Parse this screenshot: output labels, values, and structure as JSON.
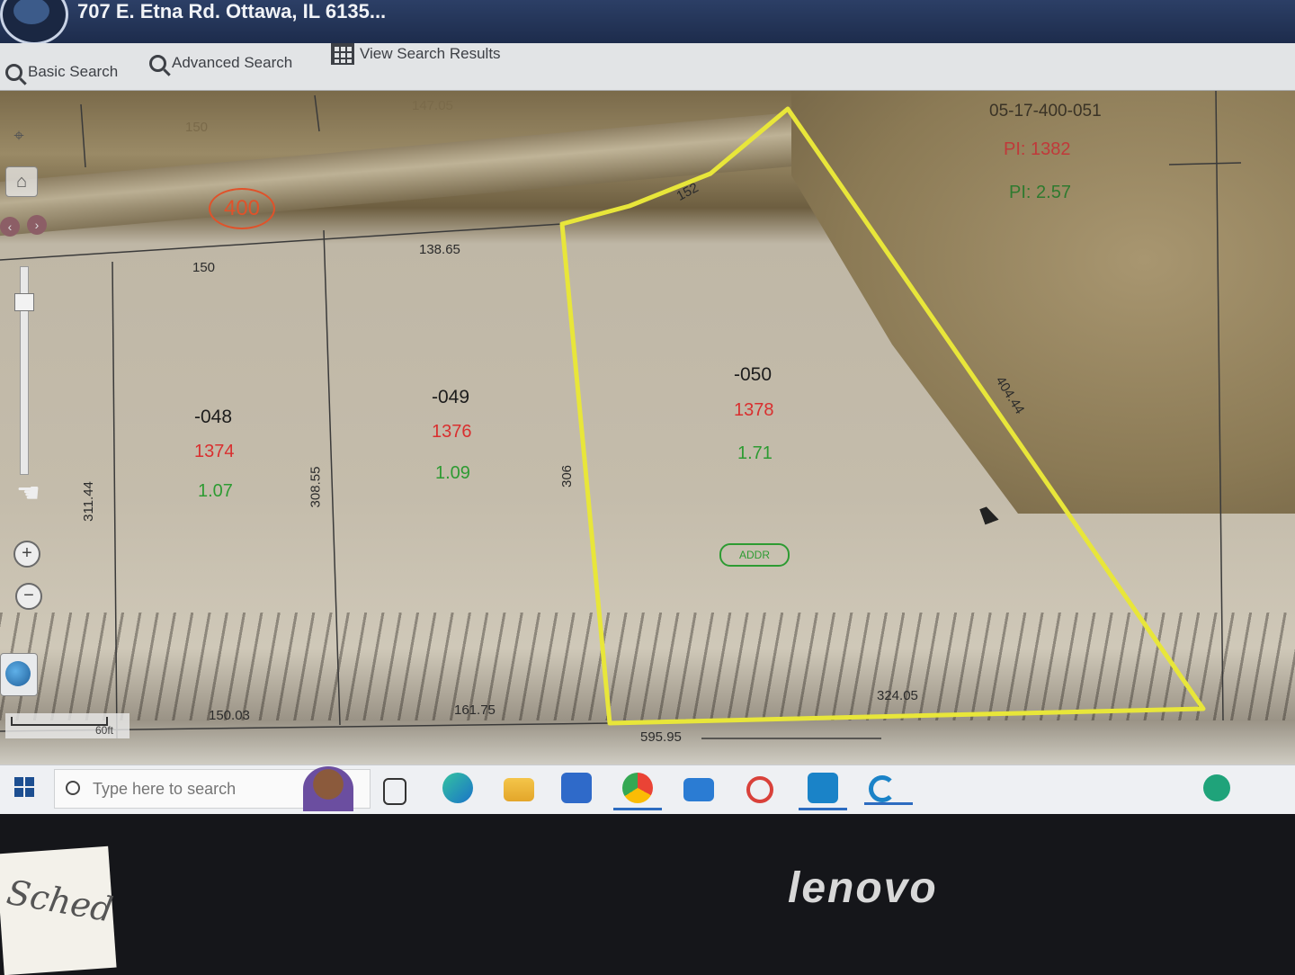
{
  "window": {
    "title": "707 E. Etna Rd. Ottawa, IL 6135..."
  },
  "toolbar": {
    "basic_search": "Basic Search",
    "advanced_search": "Advanced Search",
    "view_results": "View Search Results"
  },
  "map": {
    "parcels": [
      {
        "id": "-048",
        "pin": "1374",
        "acres": "1.07"
      },
      {
        "id": "-049",
        "pin": "1376",
        "acres": "1.09"
      },
      {
        "id": "-050",
        "pin": "1378",
        "acres": "1.71"
      }
    ],
    "neighbor": {
      "id": "05-17-400-051",
      "pin": "PI: 1382",
      "acres": "PI: 2.57"
    },
    "dimensions": {
      "d150a": "150",
      "d150b": "150",
      "d147": "147.05",
      "d152": "152",
      "d138": "138.65",
      "d311": "311.44",
      "d308": "308.55",
      "d306": "306",
      "d404": "404.44",
      "d150c": "150.03",
      "d161": "161.75",
      "d595": "595.95",
      "d324": "324.05"
    },
    "road_label": "400",
    "address_tag": "ADDR",
    "scale": "60ft",
    "colors": {
      "highlight": "#e8e63a",
      "pin": "#d92f2f",
      "acres": "#2d9b32",
      "road": "#e0522a"
    }
  },
  "nav": {
    "home_icon": "home-icon",
    "locate_icon": "crosshair-icon",
    "zoom_in": "+",
    "zoom_out": "−"
  },
  "taskbar": {
    "search_placeholder": "Type here to search",
    "apps": [
      "task-view",
      "edge",
      "file-explorer",
      "microsoft-store",
      "chrome",
      "mail",
      "app-red",
      "app-remote",
      "app-c"
    ]
  },
  "bezel": {
    "brand": "lenovo"
  },
  "note": {
    "text": "Sched"
  }
}
